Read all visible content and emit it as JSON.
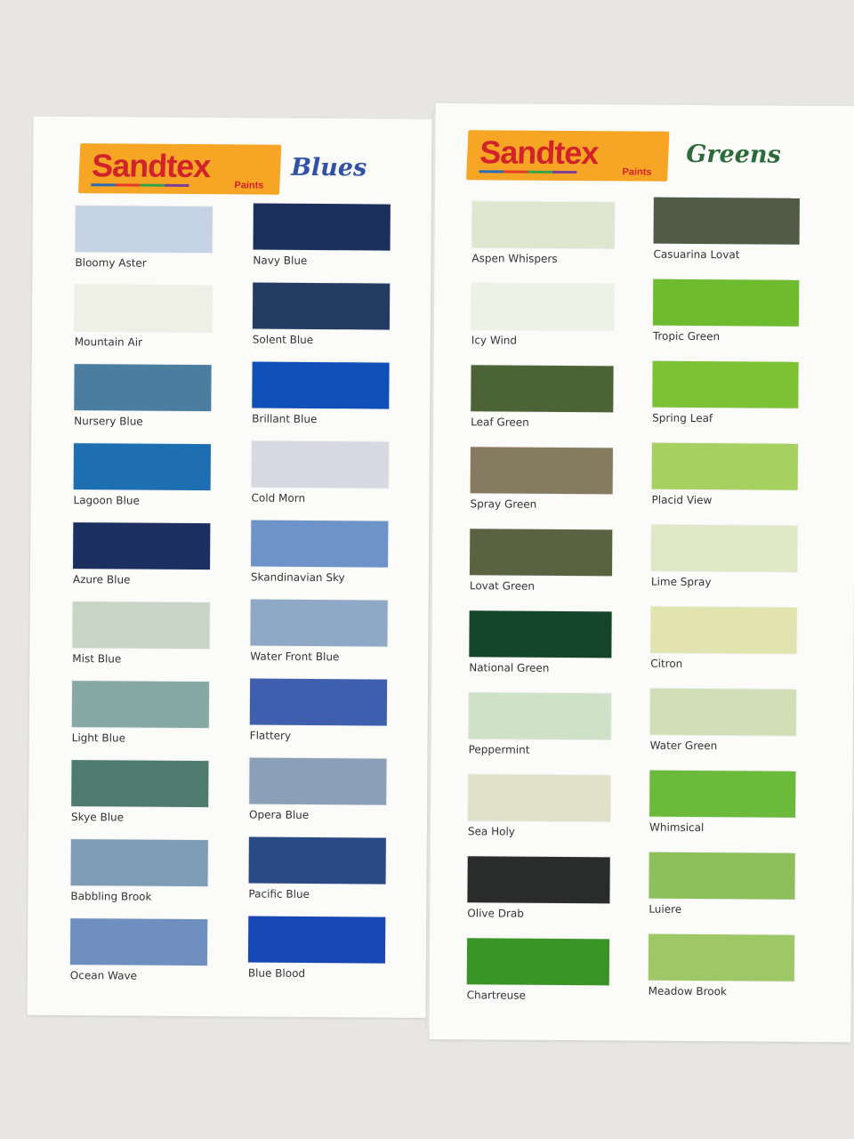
{
  "blues": {
    "brand": "Sandtex",
    "brand_sub": "Paints",
    "title": "Blues",
    "title_color": "#2f52a6",
    "col1": [
      {
        "name": "Bloomy Aster",
        "color": "#c6d3e4"
      },
      {
        "name": "Mountain Air",
        "color": "#eef0e6"
      },
      {
        "name": "Nursery Blue",
        "color": "#4a7d9f"
      },
      {
        "name": "Lagoon Blue",
        "color": "#1e6eb2"
      },
      {
        "name": "Azure Blue",
        "color": "#1b2f60"
      },
      {
        "name": "Mist Blue",
        "color": "#c8d4c6"
      },
      {
        "name": "Light Blue",
        "color": "#86a9a6"
      },
      {
        "name": "Skye Blue",
        "color": "#4f7b6f"
      },
      {
        "name": "Babbling Brook",
        "color": "#7d9db7"
      },
      {
        "name": "Ocean Wave",
        "color": "#6e8fc0"
      }
    ],
    "col2": [
      {
        "name": "Navy Blue",
        "color": "#1a2f5c"
      },
      {
        "name": "Solent Blue",
        "color": "#243b62"
      },
      {
        "name": "Brillant Blue",
        "color": "#0f4fb8"
      },
      {
        "name": "Cold Morn",
        "color": "#d6d9e1"
      },
      {
        "name": "Skandinavian Sky",
        "color": "#6e93c9"
      },
      {
        "name": "Water Front Blue",
        "color": "#8fa8c6"
      },
      {
        "name": "Flattery",
        "color": "#3f5eae"
      },
      {
        "name": "Opera Blue",
        "color": "#8ba0b6"
      },
      {
        "name": "Pacific Blue",
        "color": "#2a4a86"
      },
      {
        "name": "Blue Blood",
        "color": "#1747b4"
      }
    ]
  },
  "greens": {
    "brand": "Sandtex",
    "brand_sub": "Paints",
    "title": "Greens",
    "title_color": "#2d6a3a",
    "col1": [
      {
        "name": "Aspen Whispers",
        "color": "#dfe6cf"
      },
      {
        "name": "Icy Wind",
        "color": "#edf1e6"
      },
      {
        "name": "Leaf Green",
        "color": "#4b6335"
      },
      {
        "name": "Spray Green",
        "color": "#847b61"
      },
      {
        "name": "Lovat Green",
        "color": "#5a6242"
      },
      {
        "name": "National Green",
        "color": "#144529"
      },
      {
        "name": "Peppermint",
        "color": "#cfe1c6"
      },
      {
        "name": "Sea Holy",
        "color": "#dfe1c8"
      },
      {
        "name": "Olive Drab",
        "color": "#2a2b2b"
      },
      {
        "name": "Chartreuse",
        "color": "#3a9325"
      }
    ],
    "col2": [
      {
        "name": "Casuarina Lovat",
        "color": "#4f5a47"
      },
      {
        "name": "Tropic Green",
        "color": "#6fbb2f"
      },
      {
        "name": "Spring Leaf",
        "color": "#7ec235"
      },
      {
        "name": "Placid View",
        "color": "#a6d060"
      },
      {
        "name": "Lime Spray",
        "color": "#e0e7c6"
      },
      {
        "name": "Citron",
        "color": "#e1e4ae"
      },
      {
        "name": "Water Green",
        "color": "#d0dfb6"
      },
      {
        "name": "Whimsical",
        "color": "#6bba3b"
      },
      {
        "name": "Luiere",
        "color": "#8dc05b"
      },
      {
        "name": "Meadow Brook",
        "color": "#9ec766"
      }
    ]
  }
}
